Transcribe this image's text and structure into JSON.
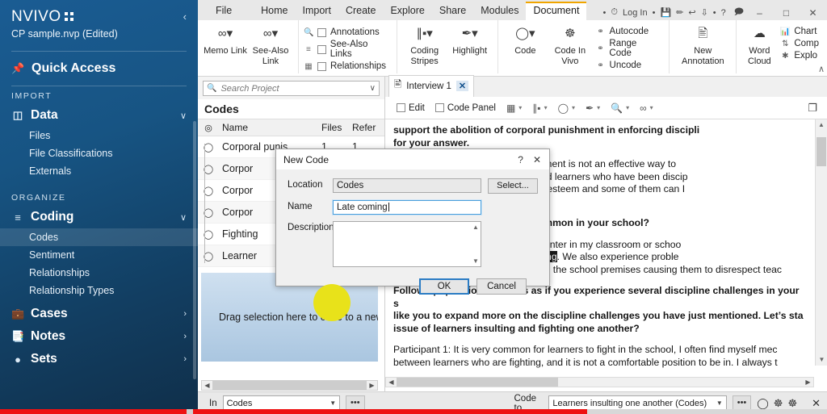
{
  "sidebar": {
    "logo": "NVIVO",
    "project": "CP sample.nvp (Edited)",
    "collapse_icon": "chevron-left-icon",
    "quick_access": "Quick Access",
    "pin_icon": "pin-icon",
    "sections": [
      {
        "label": "IMPORT",
        "groups": [
          {
            "icon": "database-icon",
            "label": "Data",
            "chevron": "∨",
            "items": [
              "Files",
              "File Classifications",
              "Externals"
            ]
          }
        ]
      },
      {
        "label": "ORGANIZE",
        "groups": [
          {
            "icon": "coding-icon",
            "label": "Coding",
            "chevron": "∨",
            "items": [
              "Codes",
              "Sentiment",
              "Relationships",
              "Relationship Types"
            ],
            "selected": "Codes"
          },
          {
            "icon": "cases-icon",
            "label": "Cases",
            "chevron": "›",
            "items": []
          },
          {
            "icon": "notes-icon",
            "label": "Notes",
            "chevron": "›",
            "items": []
          },
          {
            "icon": "sets-icon",
            "label": "Sets",
            "chevron": "›",
            "items": []
          }
        ]
      }
    ]
  },
  "ribbon": {
    "tabs": [
      "File",
      "Home",
      "Import",
      "Create",
      "Explore",
      "Share",
      "Modules",
      "Document"
    ],
    "active_tab": "Document",
    "quick_access": {
      "login": "Log In",
      "icons": [
        "clock-icon",
        "save-icon",
        "pencil-icon",
        "undo-icon",
        "redo-icon",
        "help-icon",
        "comment-icon"
      ],
      "help": "?"
    },
    "window_buttons": [
      "minimize",
      "maximize",
      "close"
    ],
    "groups": [
      {
        "name": "links",
        "buttons": [
          {
            "glyph": "link-icon",
            "label": "Memo Link"
          },
          {
            "glyph": "link-icon",
            "label": "See-Also Link"
          }
        ]
      },
      {
        "name": "show",
        "checks": [
          {
            "mini": "search-icon",
            "label": "Annotations",
            "checked": false
          },
          {
            "mini": "list-icon",
            "label": "See-Also Links",
            "checked": false
          },
          {
            "mini": "panel-icon",
            "label": "Relationships",
            "checked": false
          }
        ]
      },
      {
        "name": "visualize",
        "buttons": [
          {
            "glyph": "stripes-icon",
            "label": "Coding Stripes"
          },
          {
            "glyph": "highlighter-icon",
            "label": "Highlight"
          }
        ]
      },
      {
        "name": "code",
        "buttons": [
          {
            "glyph": "circle-icon",
            "label": "Code"
          },
          {
            "glyph": "code-in-vivo-icon",
            "label": "Code In Vivo"
          }
        ],
        "list": [
          {
            "icon": "autocode-icon",
            "label": "Autocode"
          },
          {
            "icon": "range-code-icon",
            "label": "Range Code"
          },
          {
            "icon": "uncode-icon",
            "label": "Uncode"
          }
        ]
      },
      {
        "name": "annotation",
        "buttons": [
          {
            "glyph": "new-annotation-icon",
            "label": "New Annotation"
          }
        ]
      },
      {
        "name": "explore",
        "buttons": [
          {
            "glyph": "cloud-icon",
            "label": "Word Cloud"
          }
        ],
        "list": [
          {
            "icon": "chart-icon",
            "label": "Chart"
          },
          {
            "icon": "compare-icon",
            "label": "Comp"
          },
          {
            "icon": "explore-icon",
            "label": "Explo"
          }
        ]
      }
    ],
    "collapse": "∧"
  },
  "codes_pane": {
    "search": {
      "placeholder": "Search Project",
      "value": "",
      "icon": "search-icon",
      "chevron": "∨"
    },
    "title": "Codes",
    "columns": [
      "",
      "Name",
      "Files",
      "Refer"
    ],
    "rows": [
      {
        "name": "Corporal punis",
        "files": "1",
        "refs": "1"
      },
      {
        "name": "Corpor",
        "files": "",
        "refs": ""
      },
      {
        "name": "Corpor",
        "files": "",
        "refs": ""
      },
      {
        "name": "Corpor",
        "files": "",
        "refs": ""
      },
      {
        "name": "Fighting",
        "files": "",
        "refs": ""
      },
      {
        "name": "Learner",
        "files": "",
        "refs": ""
      }
    ],
    "dropzone": "Drag selection here to code to a new "
  },
  "document": {
    "tab": {
      "label": "Interview 1",
      "close": "✕",
      "icon": "document-icon"
    },
    "toolbar": {
      "edit": "Edit",
      "code_panel": "Code Panel",
      "icons": [
        "annotation-icon",
        "stripes-icon",
        "circle-icon",
        "highlighter-icon",
        "zoom-icon",
        "link-icon"
      ],
      "right_icon": "restore-window-icon"
    },
    "paragraphs": [
      {
        "bold": true,
        "text": "support the abolition of corporal punishment in enforcing discipli\nfor your answer."
      },
      {
        "bold": false,
        "text": " support it because corporal punishment is not an effective way to\nan cause more harm than good, and learners who have been discip\nal punishment tend to have low selfesteem and some of them can I\ntting suicide."
      },
      {
        "bold": true,
        "text": "pe of discipline problems are common in your school?"
      },
      {
        "bold": false,
        "pre": "s of discipline problems that I encounter in my classroom or schoo\n insulting one another ",
        "highlight": "and late coming",
        "post": ". We also experience proble\nlearners who smoke cigarette inside the school premises causing them to disrespect teac"
      },
      {
        "bold": true,
        "text": "Follow up question: it seems as if you experience several discipline challenges in your s\nlike you to expand more on the discipline challenges you have just mentioned. Let’s sta\nissue of learners insulting and fighting one another?"
      },
      {
        "bold": false,
        "text": "Participant 1: It is very common for learners to fight in the school, I often find myself mec\nbetween learners who are fighting, and it is not a comfortable position to be in. I always t"
      }
    ]
  },
  "status_bar": {
    "in_label": "In",
    "in_value": "Codes",
    "more_button": "•••",
    "code_to_label": "Code to",
    "code_to_value": "Learners insulting one another (Codes)",
    "more_button2": "•••",
    "icons": [
      "circle-icon",
      "code-selection-icon",
      "code-in-vivo-icon"
    ],
    "close": "✕"
  },
  "dialog": {
    "title": "New Code",
    "help": "?",
    "close": "✕",
    "location_label": "Location",
    "location_value": "Codes",
    "select_button": "Select...",
    "name_label": "Name",
    "name_value": "Late coming",
    "description_label": "Description",
    "description_value": "",
    "ok_button": "OK",
    "cancel_button": "Cancel"
  },
  "colors": {
    "sidebar": "#175483",
    "accent": "#f0a500",
    "highlight_marker": "#e8e21a",
    "bottom_bar": "#ee1111",
    "dialog_focus": "#2b7cc4"
  }
}
